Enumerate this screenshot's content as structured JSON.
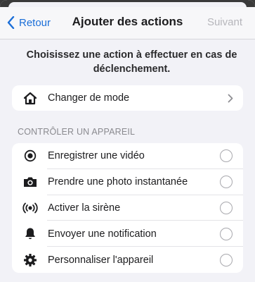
{
  "nav": {
    "back_label": "Retour",
    "title": "Ajouter des actions",
    "next_label": "Suivant"
  },
  "intro_text": "Choisissez une action à effectuer en cas de déclenchement.",
  "mode_row": {
    "label": "Changer de mode",
    "icon": "home-icon"
  },
  "section_header": "CONTRÔLER UN APPAREIL",
  "device_actions": [
    {
      "label": "Enregistrer une vidéo",
      "icon": "record-icon",
      "selected": false
    },
    {
      "label": "Prendre une photo instantanée",
      "icon": "camera-icon",
      "selected": false
    },
    {
      "label": "Activer la sirène",
      "icon": "siren-icon",
      "selected": false
    },
    {
      "label": "Envoyer une notification",
      "icon": "bell-icon",
      "selected": false
    },
    {
      "label": "Personnaliser l'appareil",
      "icon": "gear-icon",
      "selected": false
    }
  ],
  "colors": {
    "accent": "#1a6ed8",
    "background": "#f2f2f7",
    "disabled": "#b6b6bb"
  }
}
